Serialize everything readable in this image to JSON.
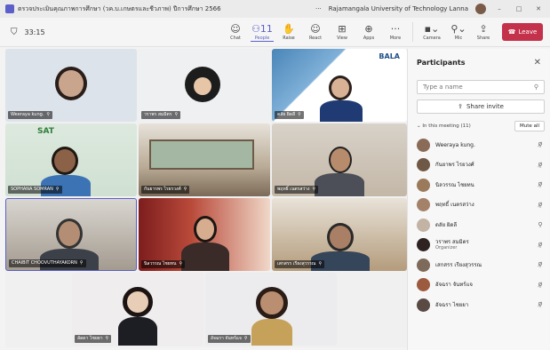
{
  "titlebar": {
    "title": "ตรวจประเมินคุณภาพการศึกษา (วค.บ.เกษตรและชีวภาพ) ปีการศึกษา 2566",
    "more": "···",
    "org": "Rajamangala University of Technology Lanna",
    "min": "–",
    "max": "□",
    "close": "✕"
  },
  "toolbar": {
    "timer": "33:15",
    "buttons": [
      {
        "label": "Chat",
        "icon": "☺"
      },
      {
        "label": "People",
        "icon": "⚇11"
      },
      {
        "label": "Raise",
        "icon": "✋"
      },
      {
        "label": "React",
        "icon": "☺"
      },
      {
        "label": "View",
        "icon": "⊞"
      },
      {
        "label": "Apps",
        "icon": "⊕"
      },
      {
        "label": "More",
        "icon": "···"
      }
    ],
    "camera": "Camera",
    "mic": "Mic",
    "share": "Share",
    "leave": "Leave"
  },
  "tiles": [
    {
      "name": "Weeraya kung."
    },
    {
      "name": "วราพร สมมิตร"
    },
    {
      "name": "ดลัย ผิดลี",
      "banner": "BALA"
    },
    {
      "name": "SOPHANA SOMRAN",
      "banner": "SAT"
    },
    {
      "name": "กันยารพร ไรยรวงศ์"
    },
    {
      "name": "พฤทธิ์ เนตรสว่าง"
    },
    {
      "name": "CHAIBIT CHOOVUTHAYAKORN"
    },
    {
      "name": "นิลวรรณ ไชยทน"
    },
    {
      "name": "เสกสรร เรียงสุวรรณ"
    },
    {
      "name": "ลัดดา ไชยยา"
    },
    {
      "name": "อัจฉรา จันทร์แจ"
    }
  ],
  "panel": {
    "title": "Participants",
    "close": "✕",
    "search_placeholder": "Type a name",
    "share_invite": "Share invite",
    "section": "⌄ In this meeting (11)",
    "mute_all": "Mute all",
    "participants": [
      {
        "name": "Weeraya kung.",
        "role": ""
      },
      {
        "name": "กันยาพร ไรยวงศ์",
        "role": ""
      },
      {
        "name": "นิลวรรณ ไชยทน",
        "role": ""
      },
      {
        "name": "พฤทธิ์ เนตรสว่าง",
        "role": ""
      },
      {
        "name": "ดลัย ผิดลี",
        "role": ""
      },
      {
        "name": "วราพร สมมิตร",
        "role": "Organizer"
      },
      {
        "name": "เสกสรร เรียงสุวรรณ",
        "role": ""
      },
      {
        "name": "อัจฉรา จันทร์แจ",
        "role": ""
      },
      {
        "name": "อัจฉรา ไชยยา",
        "role": ""
      }
    ]
  },
  "colors": {
    "accent": "#5b5fc7",
    "leave": "#c4314b"
  }
}
